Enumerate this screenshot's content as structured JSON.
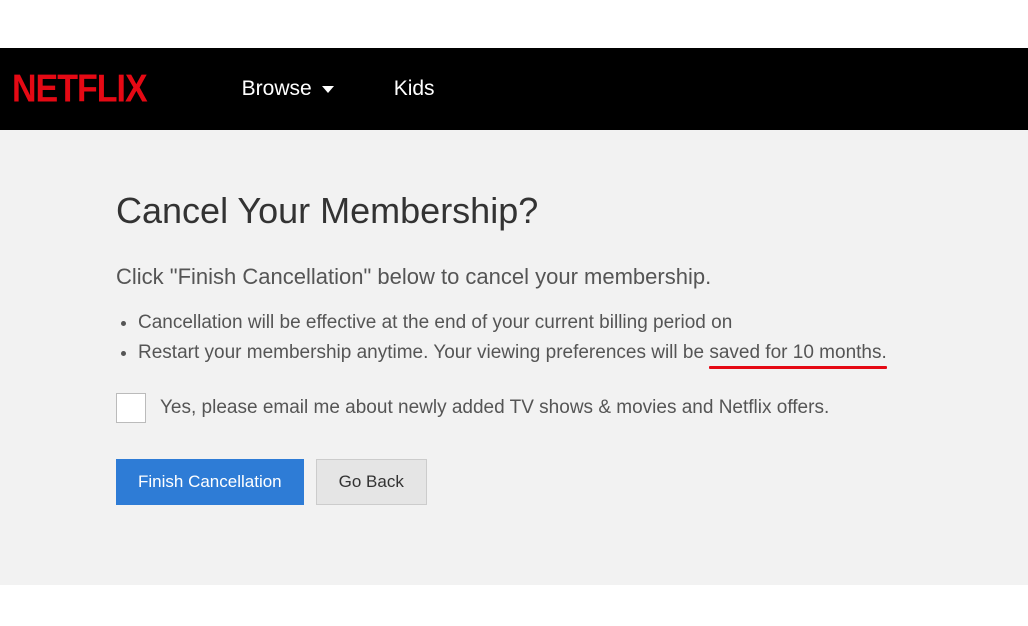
{
  "header": {
    "logo": "NETFLIX",
    "nav": {
      "browse": "Browse",
      "kids": "Kids"
    }
  },
  "main": {
    "title": "Cancel Your Membership?",
    "subtitle": "Click \"Finish Cancellation\" below to cancel your membership.",
    "bullet1": "Cancellation will be effective at the end of your current billing period on",
    "bullet2_prefix": "Restart your membership anytime. Your viewing preferences will be ",
    "bullet2_underlined": "saved for 10 months.",
    "checkbox_label": "Yes, please email me about newly added TV shows & movies and Netflix offers.",
    "buttons": {
      "finish": "Finish Cancellation",
      "back": "Go Back"
    }
  }
}
